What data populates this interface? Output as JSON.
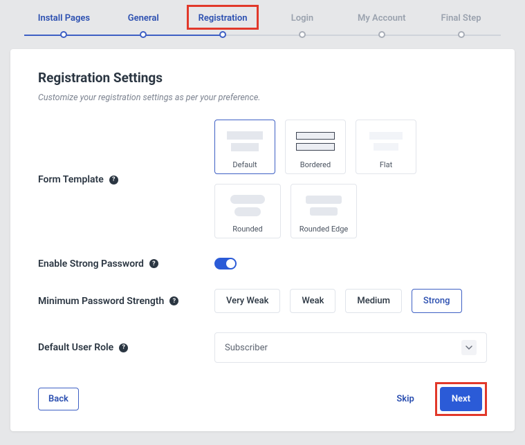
{
  "stepper": {
    "steps": [
      {
        "label": "Install Pages",
        "state": "done"
      },
      {
        "label": "General",
        "state": "done"
      },
      {
        "label": "Registration",
        "state": "active"
      },
      {
        "label": "Login",
        "state": "pending"
      },
      {
        "label": "My Account",
        "state": "pending"
      },
      {
        "label": "Final Step",
        "state": "pending"
      }
    ],
    "progress_percent": 42
  },
  "page": {
    "title": "Registration Settings",
    "subtitle": "Customize your registration settings as per your preference."
  },
  "form_template": {
    "label": "Form Template",
    "selected": "Default",
    "options": [
      "Default",
      "Bordered",
      "Flat",
      "Rounded",
      "Rounded Edge"
    ]
  },
  "strong_password": {
    "label": "Enable Strong Password",
    "value": true
  },
  "min_strength": {
    "label": "Minimum Password Strength",
    "selected": "Strong",
    "options": [
      "Very Weak",
      "Weak",
      "Medium",
      "Strong"
    ]
  },
  "default_role": {
    "label": "Default User Role",
    "value": "Subscriber"
  },
  "footer": {
    "back": "Back",
    "skip": "Skip",
    "next": "Next"
  }
}
